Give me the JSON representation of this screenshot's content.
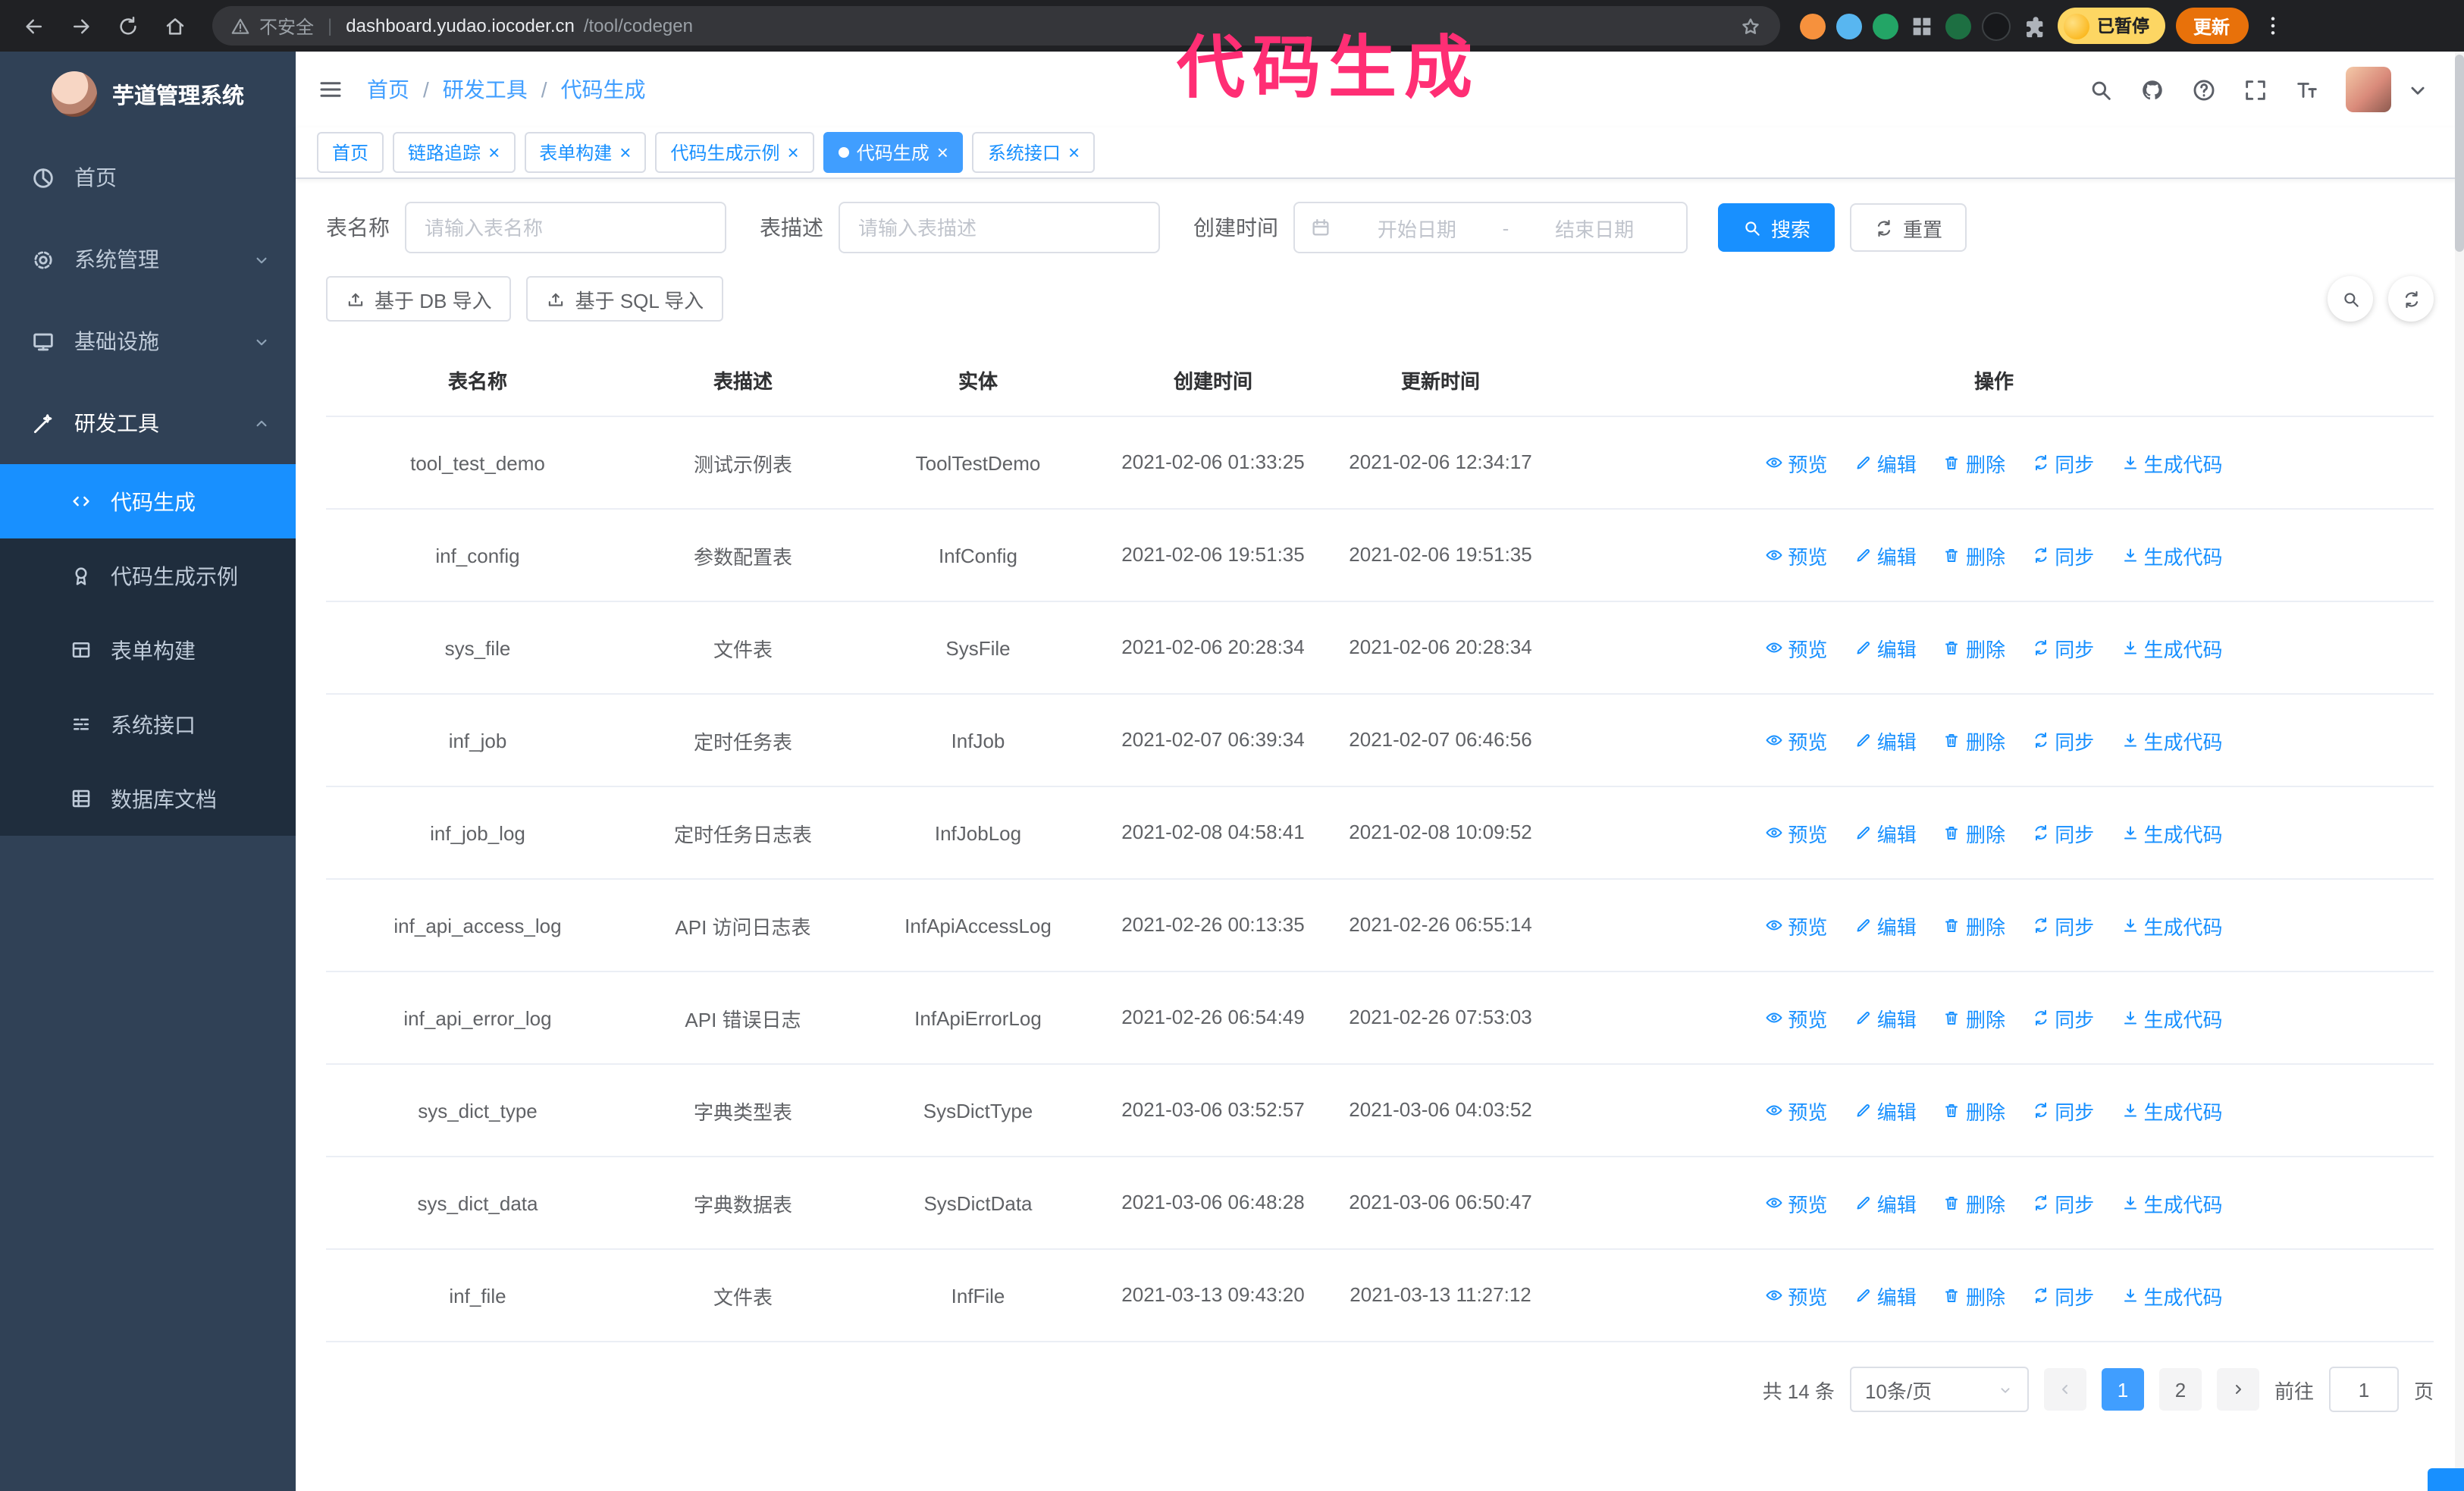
{
  "browser": {
    "warning_text": "不安全",
    "url_host": "dashboard.yudao.iocoder.cn",
    "url_path": "/tool/codegen",
    "paused_badge": "已暂停",
    "update_button": "更新"
  },
  "annotation": {
    "text": "代码生成",
    "color": "#ff2e74"
  },
  "sidebar": {
    "logo_title": "芋道管理系统",
    "items": [
      {
        "label": "首页",
        "icon": "dashboard-icon"
      },
      {
        "label": "系统管理",
        "icon": "gear-icon"
      },
      {
        "label": "基础设施",
        "icon": "monitor-icon"
      },
      {
        "label": "研发工具",
        "icon": "tools-icon",
        "expanded": true
      }
    ],
    "submenu": [
      {
        "label": "代码生成",
        "icon": "code-icon",
        "active": true
      },
      {
        "label": "代码生成示例",
        "icon": "badge-icon"
      },
      {
        "label": "表单构建",
        "icon": "form-icon"
      },
      {
        "label": "系统接口",
        "icon": "api-icon"
      },
      {
        "label": "数据库文档",
        "icon": "database-icon"
      }
    ]
  },
  "navbar": {
    "breadcrumb": [
      "首页",
      "研发工具",
      "代码生成"
    ]
  },
  "tabs": [
    {
      "label": "首页",
      "closable": false,
      "active": false
    },
    {
      "label": "链路追踪",
      "closable": true,
      "active": false
    },
    {
      "label": "表单构建",
      "closable": true,
      "active": false
    },
    {
      "label": "代码生成示例",
      "closable": true,
      "active": false
    },
    {
      "label": "代码生成",
      "closable": true,
      "active": true
    },
    {
      "label": "系统接口",
      "closable": true,
      "active": false
    }
  ],
  "filters": {
    "name_label": "表名称",
    "name_placeholder": "请输入表名称",
    "desc_label": "表描述",
    "desc_placeholder": "请输入表描述",
    "time_label": "创建时间",
    "start_placeholder": "开始日期",
    "range_separator": "-",
    "end_placeholder": "结束日期",
    "search_button": "搜索",
    "reset_button": "重置"
  },
  "toolbar": {
    "import_db": "基于 DB 导入",
    "import_sql": "基于 SQL 导入"
  },
  "table": {
    "columns": [
      "表名称",
      "表描述",
      "实体",
      "创建时间",
      "更新时间",
      "操作"
    ],
    "actions": [
      "预览",
      "编辑",
      "删除",
      "同步",
      "生成代码"
    ],
    "rows": [
      {
        "name": "tool_test_demo",
        "desc": "测试示例表",
        "entity": "ToolTestDemo",
        "created": "2021-02-06 01:33:25",
        "updated": "2021-02-06 12:34:17"
      },
      {
        "name": "inf_config",
        "desc": "参数配置表",
        "entity": "InfConfig",
        "created": "2021-02-06 19:51:35",
        "updated": "2021-02-06 19:51:35"
      },
      {
        "name": "sys_file",
        "desc": "文件表",
        "entity": "SysFile",
        "created": "2021-02-06 20:28:34",
        "updated": "2021-02-06 20:28:34"
      },
      {
        "name": "inf_job",
        "desc": "定时任务表",
        "entity": "InfJob",
        "created": "2021-02-07 06:39:34",
        "updated": "2021-02-07 06:46:56"
      },
      {
        "name": "inf_job_log",
        "desc": "定时任务日志表",
        "entity": "InfJobLog",
        "created": "2021-02-08 04:58:41",
        "updated": "2021-02-08 10:09:52"
      },
      {
        "name": "inf_api_access_log",
        "desc": "API 访问日志表",
        "entity": "InfApiAccessLog",
        "created": "2021-02-26 00:13:35",
        "updated": "2021-02-26 06:55:14"
      },
      {
        "name": "inf_api_error_log",
        "desc": "API 错误日志",
        "entity": "InfApiErrorLog",
        "created": "2021-02-26 06:54:49",
        "updated": "2021-02-26 07:53:03"
      },
      {
        "name": "sys_dict_type",
        "desc": "字典类型表",
        "entity": "SysDictType",
        "created": "2021-03-06 03:52:57",
        "updated": "2021-03-06 04:03:52"
      },
      {
        "name": "sys_dict_data",
        "desc": "字典数据表",
        "entity": "SysDictData",
        "created": "2021-03-06 06:48:28",
        "updated": "2021-03-06 06:50:47"
      },
      {
        "name": "inf_file",
        "desc": "文件表",
        "entity": "InfFile",
        "created": "2021-03-13 09:43:20",
        "updated": "2021-03-13 11:27:12"
      }
    ]
  },
  "pagination": {
    "total": "共 14 条",
    "page_size": "10条/页",
    "pages": [
      "1",
      "2"
    ],
    "goto_label": "前往",
    "goto_value": "1",
    "goto_suffix": "页"
  },
  "colors": {
    "primary": "#1890ff",
    "active_tab": "#409eff",
    "sidebar_bg": "#304156",
    "submenu_bg": "#1f2d3d",
    "annotation": "#ff2e74"
  },
  "icons": {
    "search": "magnifier",
    "github": "octocat",
    "help": "question-circle",
    "fullscreen": "expand",
    "font_size": "text-size",
    "refresh": "arrows-circle",
    "upload": "upload-arrow",
    "calendar": "calendar",
    "preview": "eye",
    "edit": "pencil",
    "delete": "trash",
    "sync": "refresh",
    "generate": "download-arrow"
  }
}
